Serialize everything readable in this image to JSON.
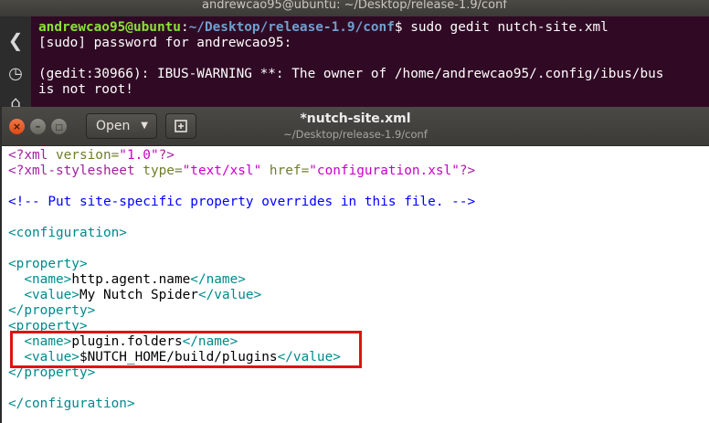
{
  "terminal": {
    "title": "andrewcao95@ubuntu: ~/Desktop/release-1.9/conf",
    "prompt_user": "andrewcao95@ubuntu",
    "prompt_sep": ":",
    "prompt_path": "~/Desktop/release-1.9/conf",
    "command": "$ sudo gedit nutch-site.xml",
    "line2": "[sudo] password for andrewcao95:",
    "line3": "",
    "line4": "(gedit:30966): IBUS-WARNING **: The owner of /home/andrewcao95/.config/ibus/bus",
    "line5": "is not root!"
  },
  "gedit": {
    "open_label": "Open",
    "title": "*nutch-site.xml",
    "path": "~/Desktop/release-1.9/conf"
  },
  "editor": {
    "l1": {
      "a": "<?xml ",
      "b": "version=",
      "c": "\"1.0\"",
      "d": "?>"
    },
    "l2": {
      "a": "<?xml-stylesheet ",
      "b": "type=",
      "c": "\"text/xsl\"",
      "d": " href=",
      "e": "\"configuration.xsl\"",
      "f": "?>"
    },
    "l4": "<!-- Put site-specific property overrides in this file. -->",
    "l6": "<configuration>",
    "l8": "<property>",
    "l9": {
      "open": "<name>",
      "text": "http.agent.name",
      "close": "</name>"
    },
    "l10": {
      "open": "<value>",
      "text": "My Nutch Spider",
      "close": "</value>"
    },
    "l11": "</property>",
    "l12": "<property>",
    "l13": {
      "open": "<name>",
      "text": "plugin.folders",
      "close": "</name>"
    },
    "l14": {
      "open": "<value>",
      "text": "$NUTCH_HOME/build/plugins",
      "close": "</value>"
    },
    "l15": "</property>",
    "l17": "</configuration>"
  },
  "colors": {
    "terminal_bg": "#300a24",
    "highlight_box": "#e01212"
  }
}
